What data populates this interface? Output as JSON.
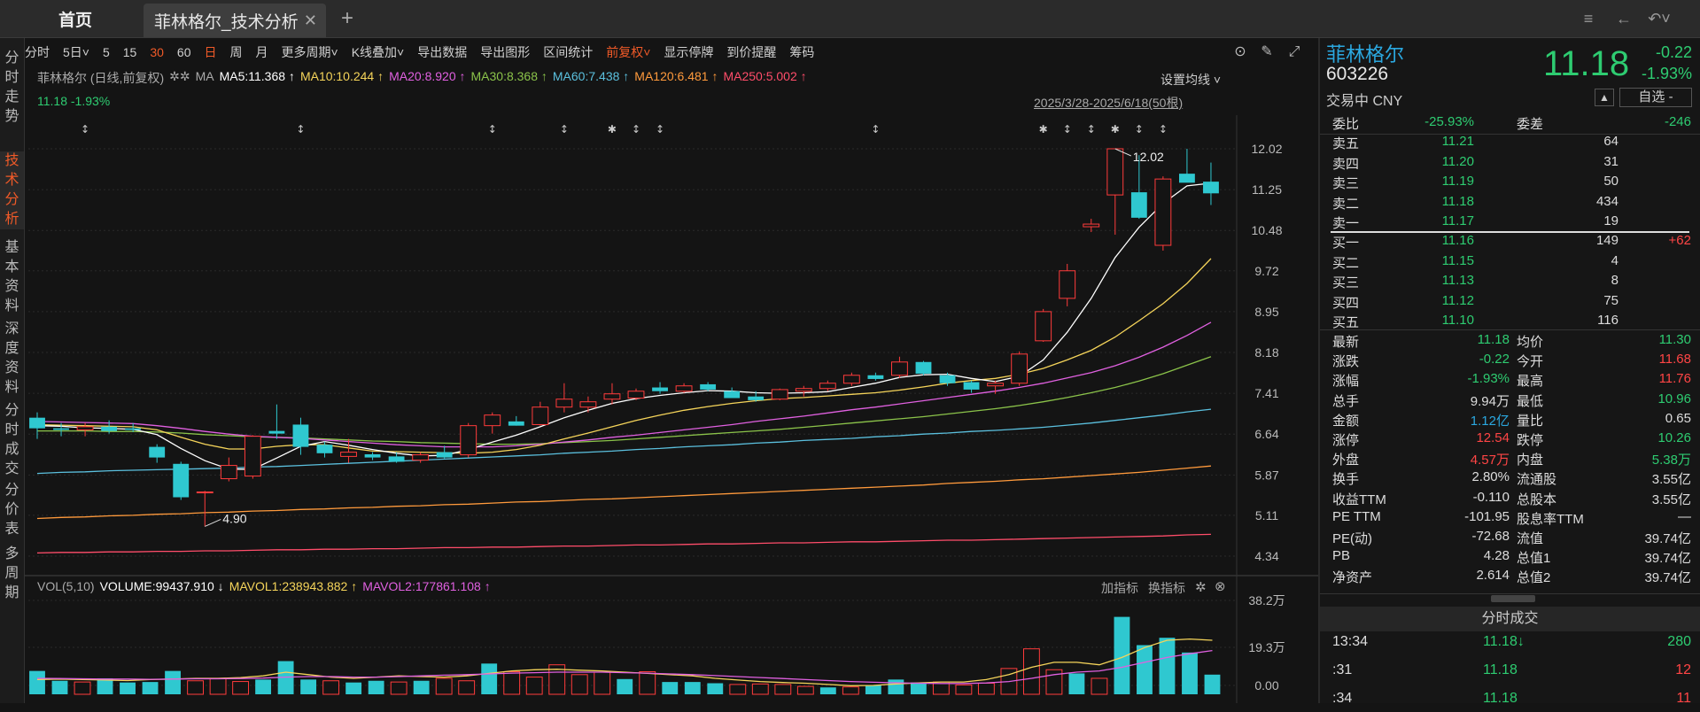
{
  "tabs": {
    "home": "首页",
    "active": "菲林格尔_技术分析",
    "close": "✕",
    "add": "+"
  },
  "window_icons": [
    "note-icon",
    "back-arrow-icon",
    "undo-icon"
  ],
  "left_nav": [
    {
      "label": "分时走势",
      "active": false
    },
    {
      "label": "技术分析",
      "active": true
    },
    {
      "label": "基本资料",
      "active": false
    },
    {
      "label": "深度资料",
      "active": false
    },
    {
      "label": "分时成交",
      "active": false
    },
    {
      "label": "分价表",
      "active": false
    },
    {
      "label": "多周期",
      "active": false
    }
  ],
  "toolbar": [
    {
      "label": "分时",
      "hl": false
    },
    {
      "label": "5日˅",
      "hl": false
    },
    {
      "label": "5",
      "hl": false
    },
    {
      "label": "15",
      "hl": false
    },
    {
      "label": "30",
      "hl": true
    },
    {
      "label": "60",
      "hl": false
    },
    {
      "label": "日",
      "hl": true
    },
    {
      "label": "周",
      "hl": false
    },
    {
      "label": "月",
      "hl": false
    },
    {
      "label": "更多周期˅",
      "hl": false
    },
    {
      "label": "K线叠加˅",
      "hl": false
    },
    {
      "label": "导出数据",
      "hl": false
    },
    {
      "label": "导出图形",
      "hl": false
    },
    {
      "label": "区间统计",
      "hl": false
    },
    {
      "label": "前复权˅",
      "hl": true
    },
    {
      "label": "显示停牌",
      "hl": false
    },
    {
      "label": "到价提醒",
      "hl": false
    },
    {
      "label": "筹码",
      "hl": false
    }
  ],
  "ma_legend": {
    "prefix": "菲林格尔 (日线,前复权)",
    "gear": "✲✲",
    "ma": "MA",
    "items": [
      {
        "text": "MA5:11.368 ↑",
        "color": "#ffffff"
      },
      {
        "text": "MA10:10.244 ↑",
        "color": "#f5d45a"
      },
      {
        "text": "MA20:8.920 ↑",
        "color": "#e060e0"
      },
      {
        "text": "MA30:8.368 ↑",
        "color": "#8bc34a"
      },
      {
        "text": "MA60:7.438 ↑",
        "color": "#5bc0de"
      },
      {
        "text": "MA120:6.481 ↑",
        "color": "#ff9a3c"
      },
      {
        "text": "MA250:5.002 ↑",
        "color": "#ff4d6a"
      }
    ],
    "setting": "设置均线 ˅"
  },
  "price_info": "11.18  -1.93%",
  "range_label": "2025/3/28-2025/6/18(50根)",
  "price_axis": [
    "12.02",
    "11.25",
    "10.48",
    "9.72",
    "8.95",
    "8.18",
    "7.41",
    "6.64",
    "5.87",
    "5.11",
    "4.34"
  ],
  "annotations": {
    "high": "12.02",
    "low": "4.90"
  },
  "chart_data": {
    "type": "candlestick",
    "ylim": [
      4.34,
      12.02
    ],
    "candles": [
      {
        "o": 6.95,
        "h": 7.05,
        "l": 6.55,
        "c": 6.75
      },
      {
        "o": 6.75,
        "h": 6.85,
        "l": 6.6,
        "c": 6.72
      },
      {
        "o": 6.72,
        "h": 6.85,
        "l": 6.6,
        "c": 6.78
      },
      {
        "o": 6.78,
        "h": 6.9,
        "l": 6.65,
        "c": 6.7
      },
      {
        "o": 6.75,
        "h": 6.85,
        "l": 6.68,
        "c": 6.72
      },
      {
        "o": 6.4,
        "h": 6.45,
        "l": 6.1,
        "c": 6.2
      },
      {
        "o": 6.08,
        "h": 6.12,
        "l": 5.4,
        "c": 5.45
      },
      {
        "o": 5.55,
        "h": 5.57,
        "l": 4.9,
        "c": 5.55
      },
      {
        "o": 5.8,
        "h": 6.2,
        "l": 5.75,
        "c": 6.05
      },
      {
        "o": 5.85,
        "h": 6.62,
        "l": 5.8,
        "c": 6.6
      },
      {
        "o": 6.7,
        "h": 7.2,
        "l": 6.55,
        "c": 6.65
      },
      {
        "o": 6.82,
        "h": 6.95,
        "l": 6.25,
        "c": 6.4
      },
      {
        "o": 6.44,
        "h": 6.5,
        "l": 6.2,
        "c": 6.28
      },
      {
        "o": 6.22,
        "h": 6.55,
        "l": 6.1,
        "c": 6.3
      },
      {
        "o": 6.26,
        "h": 6.3,
        "l": 6.15,
        "c": 6.2
      },
      {
        "o": 6.22,
        "h": 6.3,
        "l": 6.1,
        "c": 6.12
      },
      {
        "o": 6.15,
        "h": 6.3,
        "l": 6.1,
        "c": 6.25
      },
      {
        "o": 6.3,
        "h": 6.42,
        "l": 6.18,
        "c": 6.2
      },
      {
        "o": 6.25,
        "h": 6.85,
        "l": 6.2,
        "c": 6.8
      },
      {
        "o": 6.8,
        "h": 7.05,
        "l": 6.65,
        "c": 7.0
      },
      {
        "o": 6.88,
        "h": 6.98,
        "l": 6.8,
        "c": 6.8
      },
      {
        "o": 6.82,
        "h": 7.25,
        "l": 6.8,
        "c": 7.15
      },
      {
        "o": 7.15,
        "h": 7.6,
        "l": 7.05,
        "c": 7.3
      },
      {
        "o": 7.15,
        "h": 7.35,
        "l": 7.05,
        "c": 7.25
      },
      {
        "o": 7.3,
        "h": 7.6,
        "l": 7.2,
        "c": 7.4
      },
      {
        "o": 7.32,
        "h": 7.5,
        "l": 7.28,
        "c": 7.45
      },
      {
        "o": 7.52,
        "h": 7.62,
        "l": 7.4,
        "c": 7.45
      },
      {
        "o": 7.45,
        "h": 7.6,
        "l": 7.42,
        "c": 7.55
      },
      {
        "o": 7.58,
        "h": 7.62,
        "l": 7.45,
        "c": 7.48
      },
      {
        "o": 7.45,
        "h": 7.52,
        "l": 7.35,
        "c": 7.32
      },
      {
        "o": 7.35,
        "h": 7.45,
        "l": 7.25,
        "c": 7.28
      },
      {
        "o": 7.3,
        "h": 7.5,
        "l": 7.28,
        "c": 7.48
      },
      {
        "o": 7.45,
        "h": 7.55,
        "l": 7.35,
        "c": 7.5
      },
      {
        "o": 7.5,
        "h": 7.65,
        "l": 7.45,
        "c": 7.6
      },
      {
        "o": 7.6,
        "h": 7.8,
        "l": 7.55,
        "c": 7.75
      },
      {
        "o": 7.75,
        "h": 7.8,
        "l": 7.65,
        "c": 7.68
      },
      {
        "o": 7.75,
        "h": 8.1,
        "l": 7.7,
        "c": 8.0
      },
      {
        "o": 8.0,
        "h": 8.02,
        "l": 7.75,
        "c": 7.78
      },
      {
        "o": 7.75,
        "h": 7.8,
        "l": 7.55,
        "c": 7.6
      },
      {
        "o": 7.62,
        "h": 7.65,
        "l": 7.42,
        "c": 7.48
      },
      {
        "o": 7.55,
        "h": 7.65,
        "l": 7.4,
        "c": 7.6
      },
      {
        "o": 7.6,
        "h": 8.2,
        "l": 7.55,
        "c": 8.15
      },
      {
        "o": 8.4,
        "h": 9.0,
        "l": 8.38,
        "c": 8.95
      },
      {
        "o": 9.2,
        "h": 9.85,
        "l": 9.05,
        "c": 9.72
      },
      {
        "o": 10.55,
        "h": 10.7,
        "l": 10.45,
        "c": 10.6
      },
      {
        "o": 11.15,
        "h": 12.02,
        "l": 10.4,
        "c": 12.02
      },
      {
        "o": 11.2,
        "h": 11.9,
        "l": 10.7,
        "c": 10.72
      },
      {
        "o": 10.2,
        "h": 11.5,
        "l": 10.1,
        "c": 11.45
      },
      {
        "o": 11.55,
        "h": 12.02,
        "l": 11.4,
        "c": 11.38
      },
      {
        "o": 11.4,
        "h": 11.76,
        "l": 10.96,
        "c": 11.18
      }
    ],
    "ma5": [
      6.8,
      6.79,
      6.76,
      6.75,
      6.73,
      6.63,
      6.37,
      6.14,
      5.98,
      5.98,
      6.19,
      6.41,
      6.5,
      6.43,
      6.35,
      6.28,
      6.23,
      6.24,
      6.35,
      6.49,
      6.62,
      6.78,
      6.95,
      7.09,
      7.22,
      7.31,
      7.37,
      7.42,
      7.46,
      7.45,
      7.42,
      7.41,
      7.42,
      7.44,
      7.52,
      7.6,
      7.71,
      7.76,
      7.77,
      7.69,
      7.63,
      7.73,
      8.04,
      8.56,
      9.2,
      9.97,
      10.54,
      10.99,
      11.32,
      11.37
    ],
    "ma10": [
      6.82,
      6.81,
      6.8,
      6.79,
      6.78,
      6.72,
      6.58,
      6.45,
      6.36,
      6.36,
      6.41,
      6.44,
      6.44,
      6.38,
      6.32,
      6.31,
      6.3,
      6.29,
      6.28,
      6.3,
      6.35,
      6.43,
      6.55,
      6.66,
      6.78,
      6.9,
      7.0,
      7.09,
      7.16,
      7.22,
      7.27,
      7.31,
      7.33,
      7.36,
      7.39,
      7.42,
      7.47,
      7.53,
      7.6,
      7.65,
      7.69,
      7.77,
      7.88,
      8.04,
      8.22,
      8.47,
      8.78,
      9.1,
      9.48,
      9.95
    ],
    "ma20": [
      6.88,
      6.87,
      6.86,
      6.85,
      6.84,
      6.8,
      6.75,
      6.69,
      6.64,
      6.6,
      6.58,
      6.56,
      6.53,
      6.5,
      6.47,
      6.44,
      6.42,
      6.4,
      6.4,
      6.4,
      6.42,
      6.45,
      6.49,
      6.53,
      6.58,
      6.62,
      6.67,
      6.72,
      6.77,
      6.82,
      6.88,
      6.93,
      6.98,
      7.04,
      7.1,
      7.15,
      7.21,
      7.27,
      7.33,
      7.39,
      7.45,
      7.52,
      7.6,
      7.7,
      7.8,
      7.93,
      8.09,
      8.28,
      8.5,
      8.75
    ],
    "ma30": [
      6.7,
      6.7,
      6.7,
      6.69,
      6.69,
      6.68,
      6.66,
      6.63,
      6.61,
      6.59,
      6.58,
      6.57,
      6.55,
      6.53,
      6.51,
      6.5,
      6.48,
      6.47,
      6.46,
      6.45,
      6.45,
      6.46,
      6.48,
      6.5,
      6.52,
      6.55,
      6.58,
      6.61,
      6.64,
      6.67,
      6.7,
      6.73,
      6.77,
      6.81,
      6.85,
      6.89,
      6.93,
      6.97,
      7.02,
      7.07,
      7.12,
      7.18,
      7.25,
      7.33,
      7.42,
      7.52,
      7.64,
      7.78,
      7.94,
      8.1
    ],
    "ma60": [
      5.9,
      5.92,
      5.93,
      5.95,
      5.96,
      5.97,
      5.98,
      5.99,
      6.0,
      6.02,
      6.03,
      6.05,
      6.07,
      6.09,
      6.11,
      6.13,
      6.15,
      6.17,
      6.19,
      6.21,
      6.23,
      6.25,
      6.28,
      6.3,
      6.32,
      6.35,
      6.37,
      6.4,
      6.42,
      6.44,
      6.47,
      6.49,
      6.52,
      6.54,
      6.56,
      6.59,
      6.61,
      6.64,
      6.66,
      6.69,
      6.71,
      6.74,
      6.77,
      6.81,
      6.85,
      6.9,
      6.95,
      7.0,
      7.06,
      7.11
    ],
    "ma120": [
      5.05,
      5.07,
      5.08,
      5.1,
      5.11,
      5.13,
      5.14,
      5.16,
      5.17,
      5.19,
      5.2,
      5.22,
      5.23,
      5.25,
      5.26,
      5.28,
      5.29,
      5.31,
      5.32,
      5.34,
      5.36,
      5.37,
      5.39,
      5.41,
      5.42,
      5.44,
      5.46,
      5.48,
      5.5,
      5.52,
      5.54,
      5.56,
      5.58,
      5.6,
      5.62,
      5.64,
      5.66,
      5.68,
      5.71,
      5.73,
      5.75,
      5.78,
      5.8,
      5.83,
      5.86,
      5.89,
      5.92,
      5.96,
      6.0,
      6.04
    ],
    "ma250": [
      4.4,
      4.41,
      4.41,
      4.42,
      4.42,
      4.43,
      4.43,
      4.44,
      4.44,
      4.45,
      4.46,
      4.46,
      4.47,
      4.47,
      4.48,
      4.48,
      4.49,
      4.5,
      4.5,
      4.51,
      4.51,
      4.52,
      4.53,
      4.53,
      4.54,
      4.55,
      4.55,
      4.56,
      4.57,
      4.57,
      4.58,
      4.59,
      4.59,
      4.6,
      4.61,
      4.61,
      4.62,
      4.63,
      4.64,
      4.64,
      4.65,
      4.66,
      4.67,
      4.68,
      4.69,
      4.7,
      4.71,
      4.72,
      4.74,
      4.75
    ],
    "volume": {
      "ylim": [
        0,
        38.2
      ],
      "values": [
        9.5,
        5.5,
        5.0,
        6.5,
        4.8,
        5.0,
        9.5,
        5.5,
        6.5,
        5.2,
        6.0,
        13.5,
        6.0,
        5.5,
        4.8,
        5.5,
        5.0,
        5.5,
        6.5,
        5.5,
        12.5,
        9.2,
        7.0,
        12.0,
        8.0,
        9.0,
        6.2,
        9.2,
        5.0,
        5.0,
        4.5,
        4.0,
        4.2,
        4.0,
        3.2,
        2.8,
        3.0,
        3.6,
        6.0,
        4.8,
        5.0,
        3.8,
        4.5,
        10.5,
        18.5,
        10.0,
        8.5,
        6.5,
        31.5,
        20.0,
        23.0,
        17.0,
        8.0
      ],
      "mavol1": [
        6.0,
        6.2,
        6.0,
        5.8,
        5.6,
        6.0,
        6.2,
        6.5,
        6.5,
        6.8,
        7.5,
        9.0,
        8.0,
        7.0,
        6.5,
        7.0,
        7.5,
        7.2,
        7.0,
        7.5,
        8.5,
        9.5,
        10.0,
        10.2,
        9.8,
        9.5,
        9.0,
        8.5,
        8.0,
        7.5,
        6.5,
        5.8,
        5.2,
        4.8,
        4.5,
        4.0,
        3.5,
        3.6,
        4.2,
        4.6,
        5.0,
        5.0,
        6.0,
        8.0,
        11.0,
        13.0,
        13.0,
        12.0,
        15.0,
        19.0,
        22.0,
        22.5,
        22.0
      ],
      "mavol2": [
        6.5,
        6.4,
        6.3,
        6.2,
        6.2,
        6.1,
        6.2,
        6.3,
        6.3,
        6.4,
        6.6,
        7.0,
        7.2,
        7.2,
        7.0,
        7.0,
        7.2,
        7.5,
        7.8,
        8.0,
        8.3,
        8.6,
        8.8,
        9.0,
        9.0,
        9.0,
        8.8,
        8.6,
        8.3,
        8.0,
        7.6,
        7.2,
        6.8,
        6.4,
        6.0,
        5.6,
        5.2,
        4.9,
        4.7,
        4.5,
        4.4,
        4.4,
        4.6,
        5.2,
        6.5,
        8.0,
        9.0,
        9.5,
        11.0,
        13.0,
        15.0,
        16.5,
        17.8
      ]
    }
  },
  "vol_legend": {
    "title": "VOL(5,10)",
    "items": [
      {
        "text": "VOLUME:99437.910 ↓",
        "color": "#ffffff"
      },
      {
        "text": "MAVOL1:238943.882 ↑",
        "color": "#f5d45a"
      },
      {
        "text": "MAVOL2:177861.108 ↑",
        "color": "#e060e0"
      }
    ],
    "add_indicator": "加指标",
    "switch_indicator": "换指标"
  },
  "vol_axis": [
    "38.2万",
    "19.3万",
    "0.00"
  ],
  "quote": {
    "name": "菲林格尔",
    "code": "603226",
    "price": "11.18",
    "change": "-0.22",
    "pct": "-1.93%",
    "status": "交易中 CNY",
    "watch": "自选 -",
    "weibi_label": "委比",
    "weibi": "-25.93%",
    "weicha_label": "委差",
    "weicha": "-246",
    "asks": [
      {
        "label": "卖五",
        "price": "11.21",
        "vol": "64"
      },
      {
        "label": "卖四",
        "price": "11.20",
        "vol": "31"
      },
      {
        "label": "卖三",
        "price": "11.19",
        "vol": "50"
      },
      {
        "label": "卖二",
        "price": "11.18",
        "vol": "434"
      },
      {
        "label": "卖一",
        "price": "11.17",
        "vol": "19"
      }
    ],
    "bids": [
      {
        "label": "买一",
        "price": "11.16",
        "vol": "149",
        "chg": "+62"
      },
      {
        "label": "买二",
        "price": "11.15",
        "vol": "4",
        "chg": ""
      },
      {
        "label": "买三",
        "price": "11.13",
        "vol": "8",
        "chg": ""
      },
      {
        "label": "买四",
        "price": "11.12",
        "vol": "75",
        "chg": ""
      },
      {
        "label": "买五",
        "price": "11.10",
        "vol": "116",
        "chg": ""
      }
    ],
    "stats": [
      {
        "l1": "最新",
        "v1": "11.18",
        "c1": "g",
        "l2": "均价",
        "v2": "11.30",
        "c2": "g"
      },
      {
        "l1": "涨跌",
        "v1": "-0.22",
        "c1": "g",
        "l2": "今开",
        "v2": "11.68",
        "c2": "r"
      },
      {
        "l1": "涨幅",
        "v1": "-1.93%",
        "c1": "g",
        "l2": "最高",
        "v2": "11.76",
        "c2": "r"
      },
      {
        "l1": "总手",
        "v1": "9.94万",
        "c1": "w",
        "l2": "最低",
        "v2": "10.96",
        "c2": "g"
      },
      {
        "l1": "金额",
        "v1": "1.12亿",
        "c1": "b",
        "l2": "量比",
        "v2": "0.65",
        "c2": "w"
      },
      {
        "l1": "涨停",
        "v1": "12.54",
        "c1": "r",
        "l2": "跌停",
        "v2": "10.26",
        "c2": "g"
      },
      {
        "l1": "外盘",
        "v1": "4.57万",
        "c1": "r",
        "l2": "内盘",
        "v2": "5.38万",
        "c2": "g"
      },
      {
        "l1": "换手",
        "v1": "2.80%",
        "c1": "w",
        "l2": "流通股",
        "v2": "3.55亿",
        "c2": "w"
      },
      {
        "l1": "收益TTM",
        "v1": "-0.110",
        "c1": "w",
        "l2": "总股本",
        "v2": "3.55亿",
        "c2": "w"
      },
      {
        "l1": "PE TTM",
        "v1": "-101.95",
        "c1": "w",
        "l2": "股息率TTM",
        "v2": "—",
        "c2": "w"
      },
      {
        "l1": "PE(动)",
        "v1": "-72.68",
        "c1": "w",
        "l2": "流值",
        "v2": "39.74亿",
        "c2": "w"
      },
      {
        "l1": "PB",
        "v1": "4.28",
        "c1": "w",
        "l2": "总值1",
        "v2": "39.74亿",
        "c2": "w"
      },
      {
        "l1": "净资产",
        "v1": "2.614",
        "c1": "w",
        "l2": "总值2",
        "v2": "39.74亿",
        "c2": "w"
      }
    ],
    "deals_title": "分时成交",
    "deals": [
      {
        "t": "13:34",
        "p": "11.18↓",
        "v": "280",
        "pc": "g",
        "vc": "g"
      },
      {
        "t": ":31",
        "p": "11.18",
        "v": "12",
        "pc": "g",
        "vc": "r"
      },
      {
        "t": ":34",
        "p": "11.18",
        "v": "11",
        "pc": "g",
        "vc": "r"
      }
    ]
  }
}
